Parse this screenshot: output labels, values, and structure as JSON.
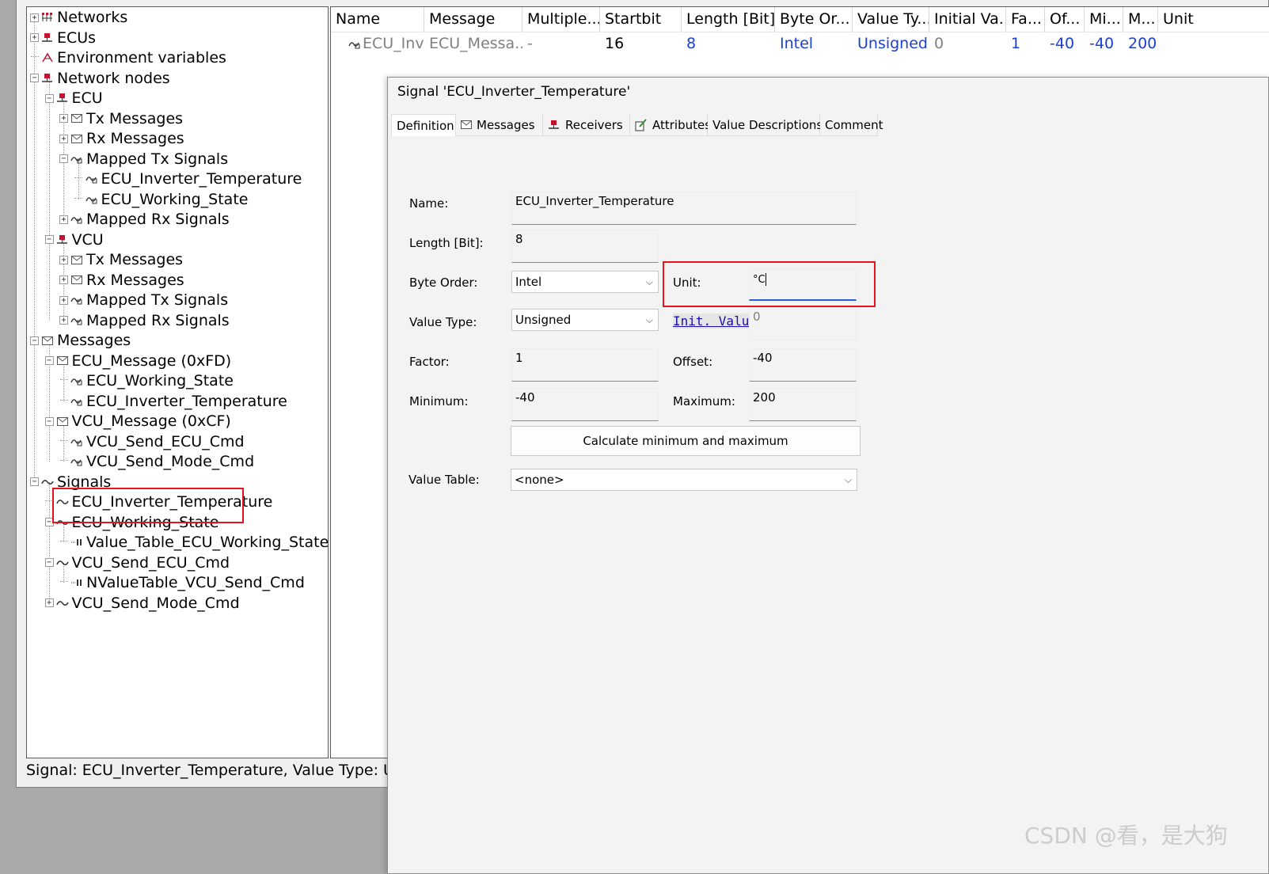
{
  "tree": {
    "items": [
      {
        "label": "Networks",
        "icon": "networks-icon"
      },
      {
        "label": "ECUs",
        "icon": "ecu-node-icon"
      },
      {
        "label": "Environment variables",
        "icon": "environment-variables-icon"
      },
      {
        "label": "Network nodes",
        "icon": "network-node-icon"
      },
      {
        "label": "ECU",
        "icon": "network-node-icon"
      },
      {
        "label": "Tx Messages",
        "icon": "message-icon"
      },
      {
        "label": "Rx Messages",
        "icon": "message-icon"
      },
      {
        "label": "Mapped Tx Signals",
        "icon": "mapped-signal-icon"
      },
      {
        "label": "ECU_Inverter_Temperature",
        "icon": "mapped-signal-icon"
      },
      {
        "label": "ECU_Working_State",
        "icon": "mapped-signal-icon"
      },
      {
        "label": "Mapped Rx Signals",
        "icon": "mapped-signal-icon"
      },
      {
        "label": "VCU",
        "icon": "network-node-icon"
      },
      {
        "label": "Tx Messages",
        "icon": "message-icon"
      },
      {
        "label": "Rx Messages",
        "icon": "message-icon"
      },
      {
        "label": "Mapped Tx Signals",
        "icon": "mapped-signal-icon"
      },
      {
        "label": "Mapped Rx Signals",
        "icon": "mapped-signal-icon"
      },
      {
        "label": "Messages",
        "icon": "message-icon"
      },
      {
        "label": "ECU_Message (0xFD)",
        "icon": "message-icon"
      },
      {
        "label": "ECU_Working_State",
        "icon": "mapped-signal-icon"
      },
      {
        "label": "ECU_Inverter_Temperature",
        "icon": "mapped-signal-icon"
      },
      {
        "label": "VCU_Message (0xCF)",
        "icon": "message-icon"
      },
      {
        "label": "VCU_Send_ECU_Cmd",
        "icon": "mapped-signal-icon"
      },
      {
        "label": "VCU_Send_Mode_Cmd",
        "icon": "mapped-signal-icon"
      },
      {
        "label": "Signals",
        "icon": "signal-wave-icon"
      },
      {
        "label": "ECU_Inverter_Temperature",
        "icon": "signal-wave-icon"
      },
      {
        "label": "ECU_Working_State",
        "icon": "signal-wave-icon"
      },
      {
        "label": "Value_Table_ECU_Working_State",
        "icon": "value-table-icon"
      },
      {
        "label": "VCU_Send_ECU_Cmd",
        "icon": "signal-wave-icon"
      },
      {
        "label": "NValueTable_VCU_Send_Cmd",
        "icon": "value-table-icon"
      },
      {
        "label": "VCU_Send_Mode_Cmd",
        "icon": "signal-wave-icon"
      }
    ]
  },
  "status": {
    "text": "Signal: ECU_Inverter_Temperature,    Value Type: Unsig"
  },
  "grid": {
    "headers": [
      "Name",
      "Message",
      "Multiple...",
      "Startbit",
      "Length [Bit]",
      "Byte Or...",
      "Value Ty...",
      "Initial Va...",
      "Fa...",
      "Of...",
      "Mi...",
      "M...",
      "Unit"
    ],
    "row": [
      "ECU_Inv...",
      "ECU_Messa...",
      "-",
      "16",
      "8",
      "Intel",
      "Unsigned",
      "0",
      "1",
      "-40",
      "-40",
      "200",
      ""
    ]
  },
  "dialog": {
    "title": "Signal 'ECU_Inverter_Temperature'",
    "tabs": [
      {
        "label": "Definition",
        "icon": ""
      },
      {
        "label": "Messages",
        "icon": "message-icon"
      },
      {
        "label": "Receivers",
        "icon": "receiver-node-icon"
      },
      {
        "label": "Attributes",
        "icon": "attributes-icon"
      },
      {
        "label": "Value Descriptions",
        "icon": ""
      },
      {
        "label": "Comment",
        "icon": ""
      }
    ],
    "form": {
      "name_label": "Name:",
      "name_value": "ECU_Inverter_Temperature",
      "length_label": "Length [Bit]:",
      "length_value": "8",
      "byte_order_label": "Byte Order:",
      "byte_order_value": "Intel",
      "unit_label": "Unit:",
      "unit_value": "°C",
      "value_type_label": "Value Type:",
      "value_type_value": "Unsigned",
      "init_value_label": "Init. Value",
      "init_value_value": "0",
      "factor_label": "Factor:",
      "factor_value": "1",
      "offset_label": "Offset:",
      "offset_value": "-40",
      "minimum_label": "Minimum:",
      "minimum_value": "-40",
      "maximum_label": "Maximum:",
      "maximum_value": "200",
      "calc_button": "Calculate minimum and maximum",
      "value_table_label": "Value Table:",
      "value_table_value": "<none>"
    }
  },
  "watermark": "CSDN @看，是大狗",
  "colors": {
    "highlight_frame": "#e3141b",
    "value_blue": "#1b3fd6",
    "link_blue": "#1a0dab"
  }
}
